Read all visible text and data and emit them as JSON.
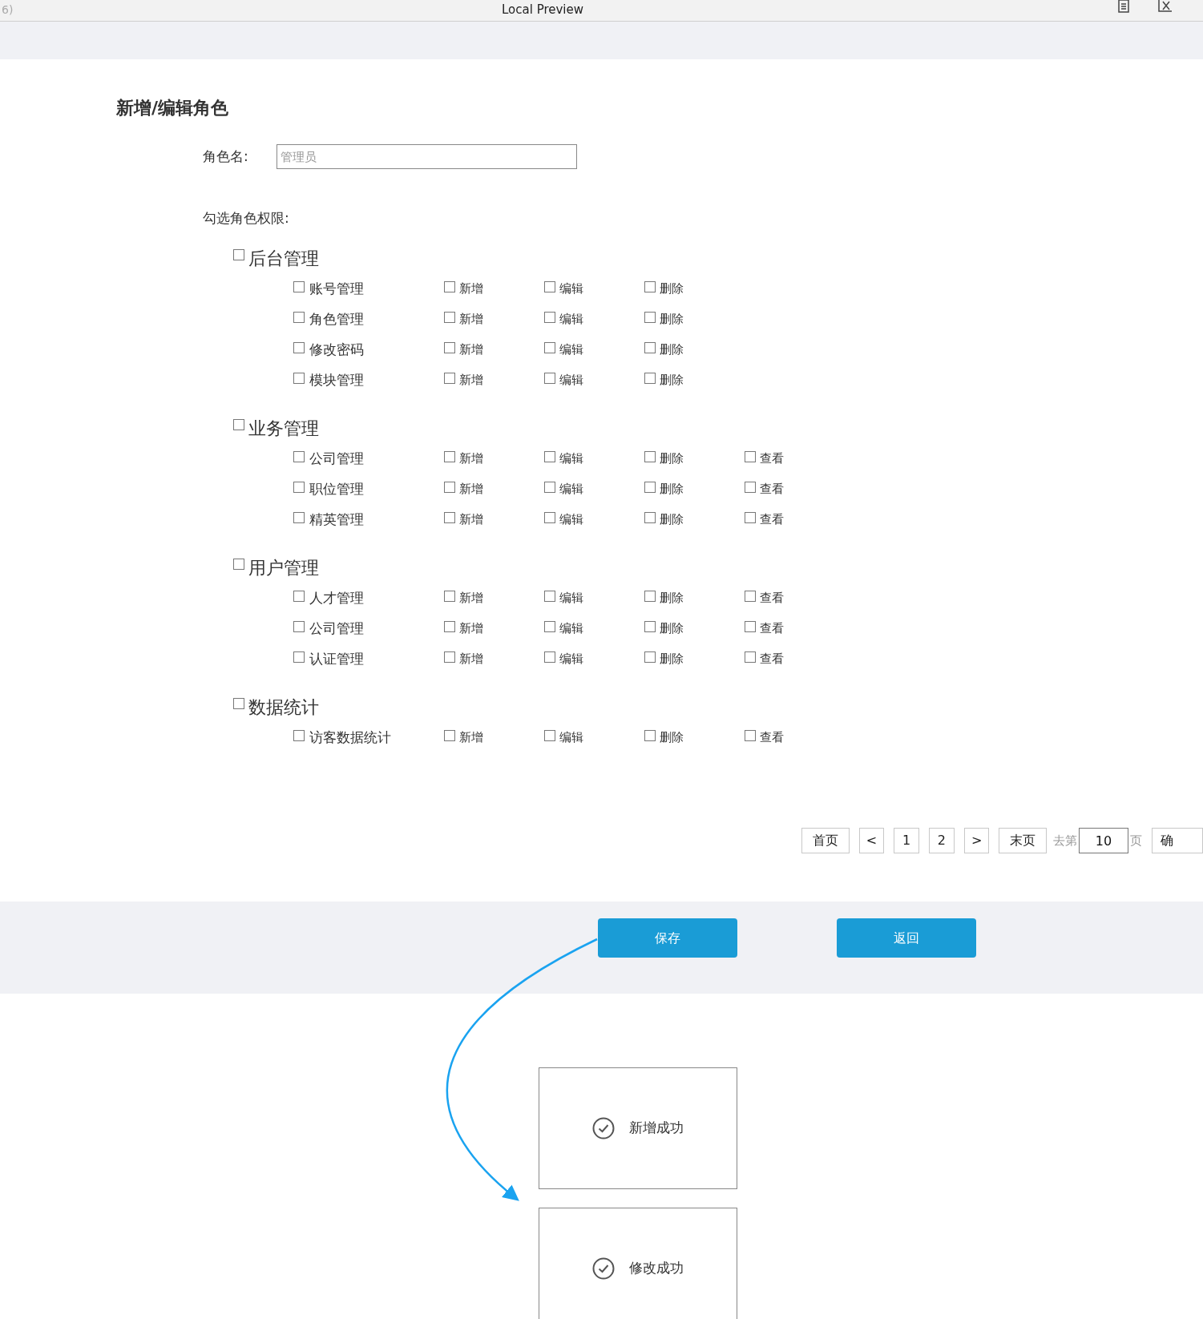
{
  "top_bar": {
    "left_text": "6)",
    "title": "Local Preview"
  },
  "form": {
    "title": "新增/编辑角色",
    "role_name": {
      "label": "角色名:",
      "placeholder": "管理员"
    },
    "permissions_label": "勾选角色权限:"
  },
  "groups": [
    {
      "label": "后台管理",
      "checked": false,
      "rows": [
        {
          "label": "账号管理",
          "checked": false,
          "permissions": [
            {
              "label": "新增",
              "checked": false
            },
            {
              "label": "编辑",
              "checked": false
            },
            {
              "label": "删除",
              "checked": false
            }
          ]
        },
        {
          "label": "角色管理",
          "checked": false,
          "permissions": [
            {
              "label": "新增",
              "checked": false
            },
            {
              "label": "编辑",
              "checked": false
            },
            {
              "label": "删除",
              "checked": false
            }
          ]
        },
        {
          "label": "修改密码",
          "checked": false,
          "permissions": [
            {
              "label": "新增",
              "checked": false
            },
            {
              "label": "编辑",
              "checked": false
            },
            {
              "label": "删除",
              "checked": false
            }
          ]
        },
        {
          "label": "模块管理",
          "checked": false,
          "permissions": [
            {
              "label": "新增",
              "checked": false
            },
            {
              "label": "编辑",
              "checked": false
            },
            {
              "label": "删除",
              "checked": false
            }
          ]
        }
      ]
    },
    {
      "label": "业务管理",
      "checked": false,
      "rows": [
        {
          "label": "公司管理",
          "checked": false,
          "permissions": [
            {
              "label": "新增",
              "checked": false
            },
            {
              "label": "编辑",
              "checked": false
            },
            {
              "label": "删除",
              "checked": false
            },
            {
              "label": "查看",
              "checked": false
            }
          ]
        },
        {
          "label": "职位管理",
          "checked": false,
          "permissions": [
            {
              "label": "新增",
              "checked": false
            },
            {
              "label": "编辑",
              "checked": false
            },
            {
              "label": "删除",
              "checked": false
            },
            {
              "label": "查看",
              "checked": false
            }
          ]
        },
        {
          "label": "精英管理",
          "checked": false,
          "permissions": [
            {
              "label": "新增",
              "checked": false
            },
            {
              "label": "编辑",
              "checked": false
            },
            {
              "label": "删除",
              "checked": false
            },
            {
              "label": "查看",
              "checked": false
            }
          ]
        }
      ]
    },
    {
      "label": "用户管理",
      "checked": false,
      "rows": [
        {
          "label": "人才管理",
          "checked": false,
          "permissions": [
            {
              "label": "新增",
              "checked": false
            },
            {
              "label": "编辑",
              "checked": false
            },
            {
              "label": "删除",
              "checked": false
            },
            {
              "label": "查看",
              "checked": false
            }
          ]
        },
        {
          "label": "公司管理",
          "checked": false,
          "permissions": [
            {
              "label": "新增",
              "checked": false
            },
            {
              "label": "编辑",
              "checked": false
            },
            {
              "label": "删除",
              "checked": false
            },
            {
              "label": "查看",
              "checked": false
            }
          ]
        },
        {
          "label": "认证管理",
          "checked": false,
          "permissions": [
            {
              "label": "新增",
              "checked": false
            },
            {
              "label": "编辑",
              "checked": false
            },
            {
              "label": "删除",
              "checked": false
            },
            {
              "label": "查看",
              "checked": false
            }
          ]
        }
      ]
    },
    {
      "label": "数据统计",
      "checked": false,
      "rows": [
        {
          "label": "访客数据统计",
          "checked": false,
          "permissions": [
            {
              "label": "新增",
              "checked": false
            },
            {
              "label": "编辑",
              "checked": false
            },
            {
              "label": "删除",
              "checked": false
            },
            {
              "label": "查看",
              "checked": false
            }
          ]
        }
      ]
    }
  ],
  "pagination": {
    "first": "首页",
    "prev": "<",
    "pages": [
      {
        "label": "1"
      },
      {
        "label": "2"
      }
    ],
    "next": ">",
    "last": "末页",
    "goto_prefix": "去第",
    "goto_value": "10",
    "goto_suffix": "页",
    "confirm": "确"
  },
  "actions": {
    "save": "保存",
    "back": "返回"
  },
  "messages": [
    {
      "text": "新增成功"
    },
    {
      "text": "修改成功"
    }
  ]
}
